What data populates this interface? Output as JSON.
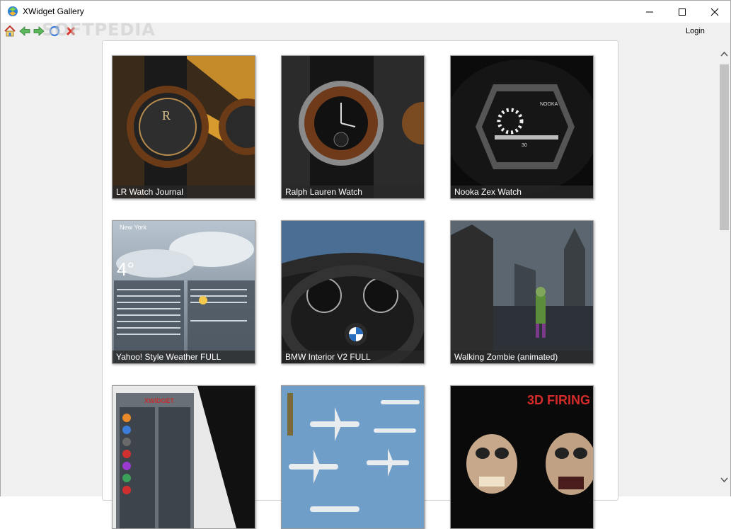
{
  "window": {
    "title": "XWidget Gallery",
    "app_icon": "xwidget-logo-icon"
  },
  "toolbar": {
    "icons": [
      "home-icon",
      "back-icon",
      "forward-icon",
      "refresh-icon",
      "stop-icon"
    ],
    "watermark": "SOFTPEDIA",
    "login_label": "Login"
  },
  "gallery": {
    "tiles": [
      {
        "caption": "LR Watch Journal"
      },
      {
        "caption": "Ralph Lauren Watch"
      },
      {
        "caption": "Nooka Zex Watch"
      },
      {
        "caption": "Yahoo! Style Weather FULL"
      },
      {
        "caption": "BMW Interior V2 FULL"
      },
      {
        "caption": "Walking Zombie (animated)"
      },
      {
        "caption": ""
      },
      {
        "caption": ""
      },
      {
        "caption": ""
      }
    ],
    "art_text": {
      "weather_city": "New York",
      "weather_temp": "4°",
      "nooka_brand": "NOOKA",
      "nooka_num": "30",
      "firing_title": "3D FIRING",
      "xwidget_banner": "XWIDGET"
    }
  },
  "colors": {
    "accent": "#1e73be",
    "caption_bg": "#282828",
    "panel_bg": "#ffffff",
    "background": "#f0f0f0"
  }
}
